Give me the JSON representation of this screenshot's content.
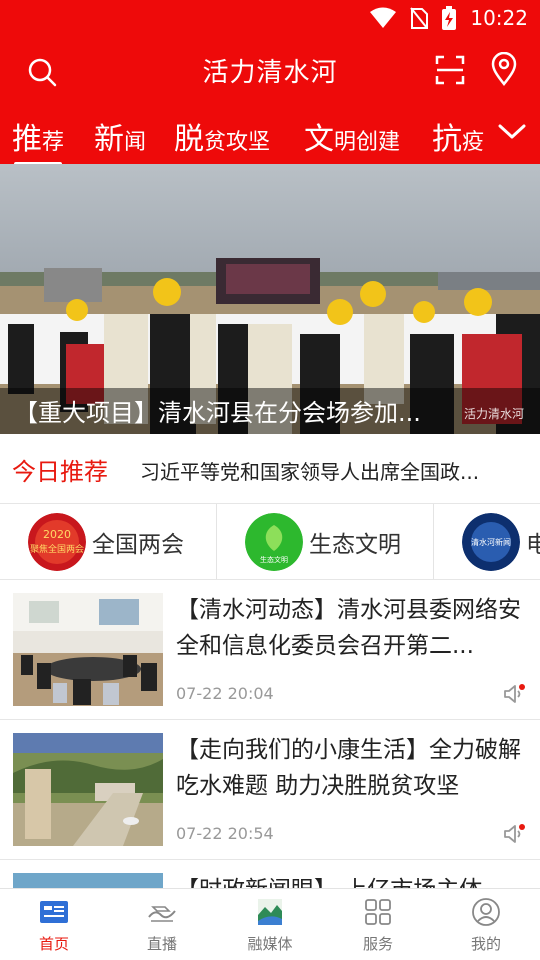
{
  "status_bar": {
    "time": "10:22"
  },
  "header": {
    "title": "活力清水河"
  },
  "tabs": [
    {
      "big": "推",
      "small": "荐"
    },
    {
      "big": "新",
      "small": "闻"
    },
    {
      "big": "脱",
      "small": "贫攻坚"
    },
    {
      "big": "文",
      "small": "明创建"
    },
    {
      "big": "抗",
      "small": "疫"
    }
  ],
  "banner": {
    "caption": "【重大项目】清水河县在分会场参加...",
    "watermark": "活力清水河"
  },
  "today": {
    "label": "今日推荐",
    "text": "习近平等党和国家领导人出席全国政..."
  },
  "topics": [
    {
      "name": "全国两会",
      "badge": "2020 聚焦全国两会"
    },
    {
      "name": "生态文明",
      "badge": "生态文明"
    },
    {
      "name": "电",
      "badge": "清水河新闻"
    }
  ],
  "news": [
    {
      "title": "【清水河动态】清水河县委网络安全和信息化委员会召开第二...",
      "time": "07-22 20:04"
    },
    {
      "title": "【走向我们的小康生活】全力破解吃水难题 助力决胜脱贫攻坚",
      "time": "07-22 20:54"
    },
    {
      "title": "【时政新闻眼】 上亿市场主体",
      "time": ""
    }
  ],
  "bottom_nav": [
    {
      "label": "首页",
      "icon": "news-icon",
      "active": true
    },
    {
      "label": "直播",
      "icon": "live-icon",
      "active": false
    },
    {
      "label": "融媒体",
      "icon": "media-icon",
      "active": false
    },
    {
      "label": "服务",
      "icon": "grid-icon",
      "active": false
    },
    {
      "label": "我的",
      "icon": "user-icon",
      "active": false
    }
  ],
  "colors": {
    "brand_red": "#ee0a0a",
    "accent_red": "#e8190f",
    "active_blue": "#2f6fd6"
  }
}
